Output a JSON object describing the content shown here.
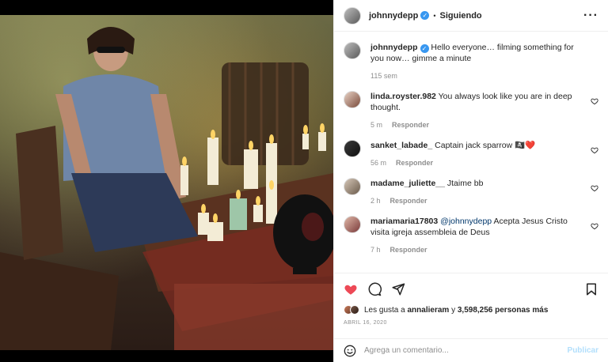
{
  "post": {
    "author": "johnnydepp",
    "follow_status": "Siguiendo",
    "caption_author": "johnnydepp",
    "caption": "Hello everyone… filming something for you now… gimme a minute",
    "caption_time": "115 sem"
  },
  "comments": [
    {
      "user": "linda.royster.982",
      "text": "You always look like you are in deep thought.",
      "time": "5 m",
      "reply": "Responder",
      "mention": ""
    },
    {
      "user": "sanket_labade_",
      "text": "Captain jack sparrow 🏴‍☠️❤️",
      "time": "56 m",
      "reply": "Responder",
      "mention": ""
    },
    {
      "user": "madame_juliette__",
      "text": "Jtaime bb",
      "time": "2 h",
      "reply": "Responder",
      "mention": ""
    },
    {
      "user": "mariamaria17803",
      "mention": "@johnnydepp",
      "text": "Acepta Jesus Cristo visita igreja assembleia de Deus",
      "time": "7 h",
      "reply": "Responder"
    }
  ],
  "likes": {
    "prefix": "Les gusta a",
    "user": "annalieram",
    "conj": "y",
    "count": "3,598,256 personas más"
  },
  "date": "ABRIL 16, 2020",
  "add_comment": {
    "placeholder": "Agrega un comentario...",
    "post_label": "Publicar"
  },
  "icons": {
    "more": "more-options-icon",
    "like": "heart-filled-icon",
    "comment": "comment-icon",
    "share": "share-icon",
    "save": "bookmark-icon",
    "emoji": "emoji-icon",
    "verified": "verified-badge-icon"
  },
  "colors": {
    "like_red": "#ed4956",
    "verified_blue": "#3897f0",
    "publish_disabled": "#b2dffc"
  }
}
